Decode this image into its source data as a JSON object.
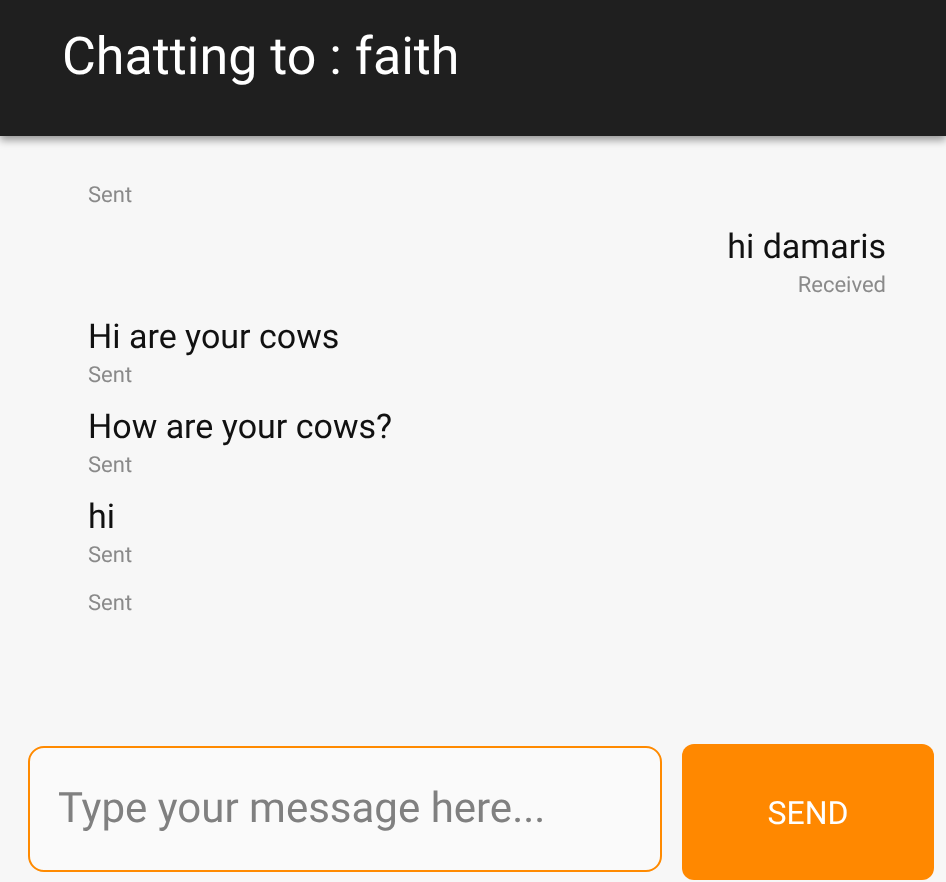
{
  "header": {
    "title": "Chatting to : faith"
  },
  "messages": [
    {
      "kind": "sent",
      "status": "Sent"
    },
    {
      "kind": "received",
      "text": "hi damaris",
      "status": "Received"
    },
    {
      "kind": "sent",
      "text": "Hi are your cows",
      "status": "Sent"
    },
    {
      "kind": "sent",
      "text": "How are your cows?",
      "status": "Sent"
    },
    {
      "kind": "sent",
      "text": "hi",
      "status": "Sent"
    },
    {
      "kind": "sent",
      "status": "Sent"
    }
  ],
  "composer": {
    "placeholder": "Type your message here...",
    "button": "SEND"
  }
}
